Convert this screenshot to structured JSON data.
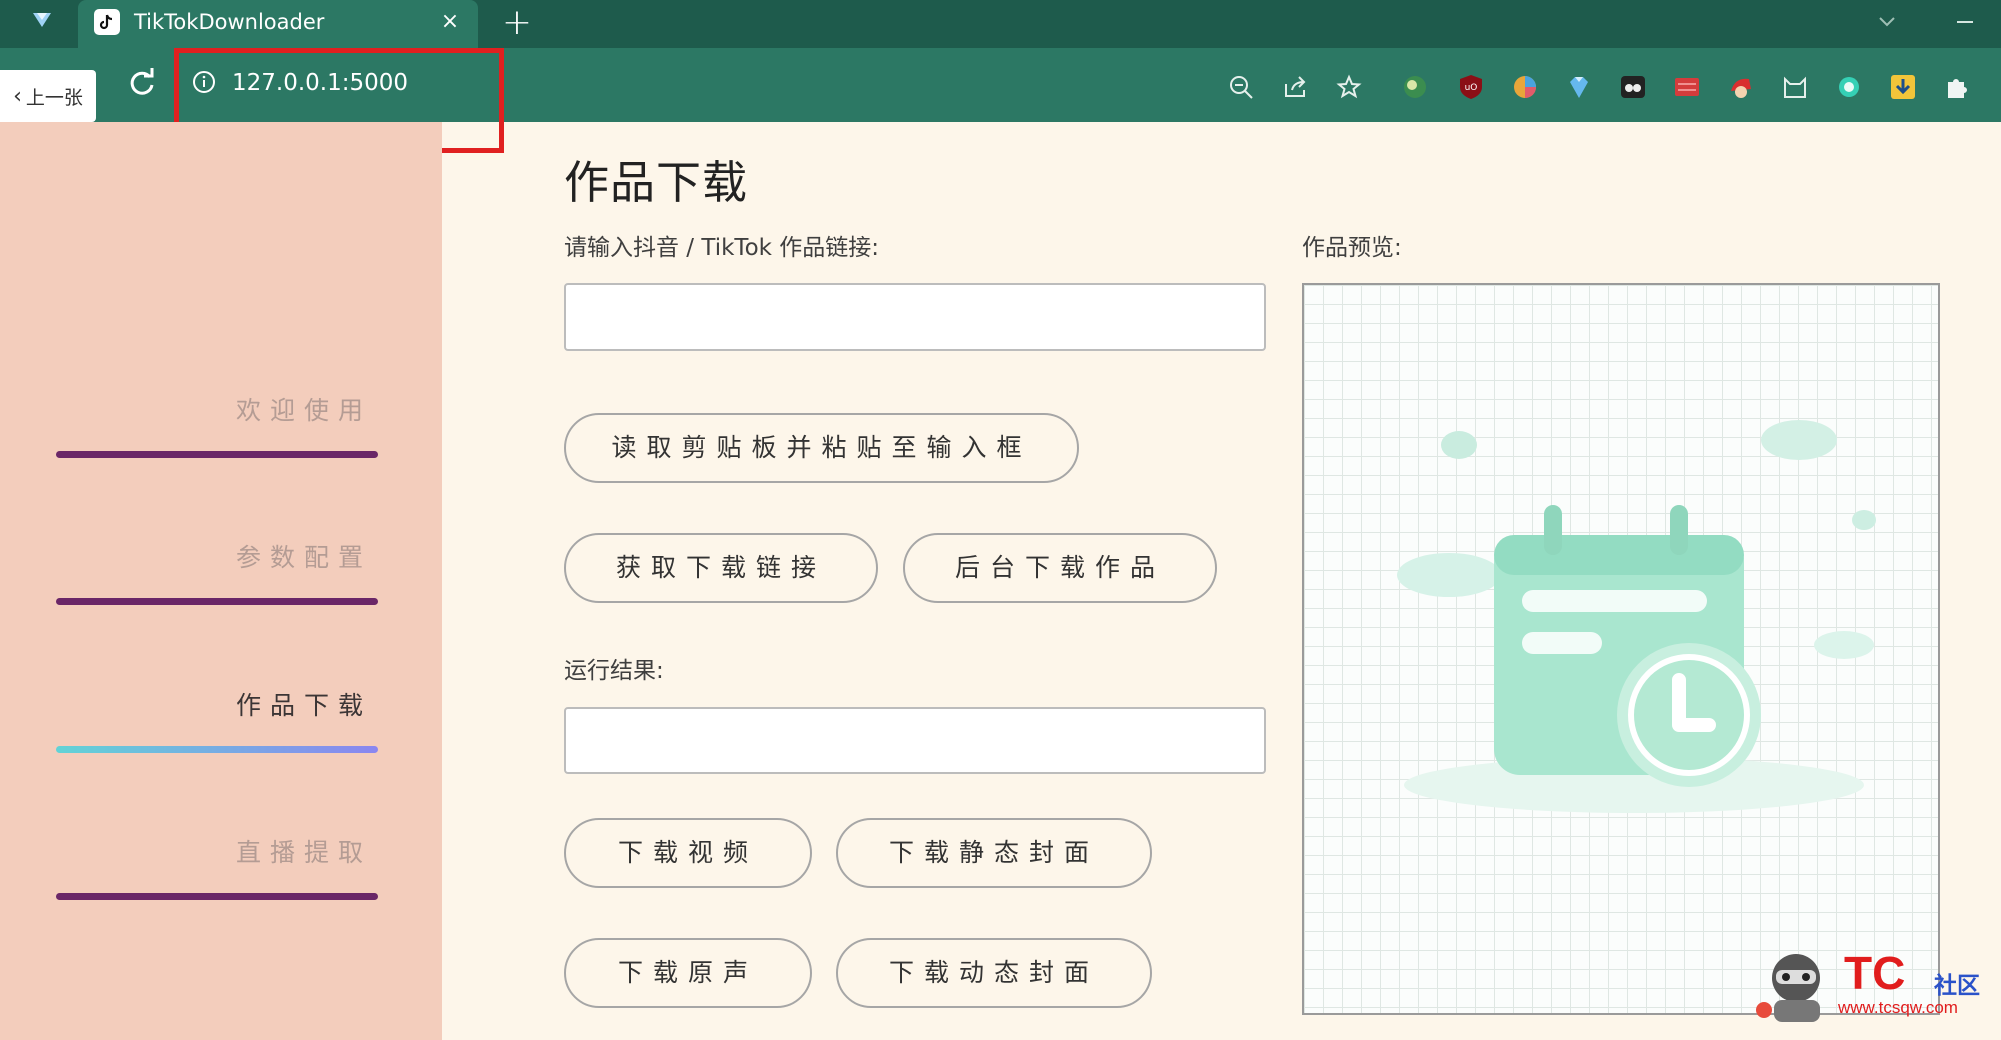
{
  "browser": {
    "tab_title": "TikTokDownloader",
    "tab_close": "×",
    "new_tab": "+",
    "prev_label": "上一张",
    "url": "127.0.0.1:5000"
  },
  "sidebar": {
    "items": [
      {
        "label": "欢迎使用"
      },
      {
        "label": "参数配置"
      },
      {
        "label": "作品下载"
      },
      {
        "label": "直播提取"
      }
    ]
  },
  "main": {
    "title": "作品下载",
    "link_label": "请输入抖音 / TikTok 作品链接:",
    "link_value": "",
    "paste_button": "读取剪贴板并粘贴至输入框",
    "get_link_button": "获取下载链接",
    "bg_download_button": "后台下载作品",
    "result_label": "运行结果:",
    "result_value": "",
    "download_video_button": "下载视频",
    "download_static_cover_button": "下载静态封面",
    "download_audio_button": "下载原声",
    "download_dynamic_cover_button": "下载动态封面",
    "preview_label": "作品预览:"
  },
  "watermark": {
    "brand": "TC",
    "brand2": "社区",
    "url": "www.tcsqw.com"
  },
  "colors": {
    "tabbar": "#1e5b4c",
    "toolbar": "#2c7864",
    "sidebar": "#f3cdbc",
    "content_bg": "#fdf6ea",
    "nav_line": "#6a2667",
    "highlight": "#e02020"
  }
}
